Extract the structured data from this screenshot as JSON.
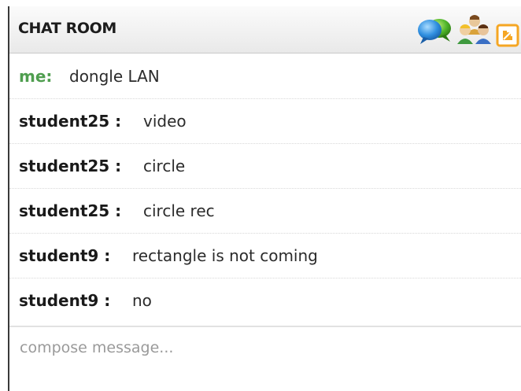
{
  "header": {
    "title": "CHAT ROOM",
    "icons": [
      "chat-bubbles-icon",
      "users-icon",
      "popout-icon"
    ],
    "accent_color": "#f5a623"
  },
  "messages": [
    {
      "sender": "me:",
      "text": "dongle LAN",
      "is_self": true
    },
    {
      "sender": "student25 :",
      "text": "video",
      "is_self": false
    },
    {
      "sender": "student25 :",
      "text": "circle",
      "is_self": false
    },
    {
      "sender": "student25 :",
      "text": "circle rec",
      "is_self": false
    },
    {
      "sender": "student9 :",
      "text": "rectangle is not coming",
      "is_self": false
    },
    {
      "sender": "student9 :",
      "text": "no",
      "is_self": false
    }
  ],
  "compose": {
    "placeholder": "compose message...",
    "value": ""
  },
  "colors": {
    "self_sender": "#4f9e4f",
    "sender": "#1a1a1a",
    "text": "#2b2b2b"
  }
}
